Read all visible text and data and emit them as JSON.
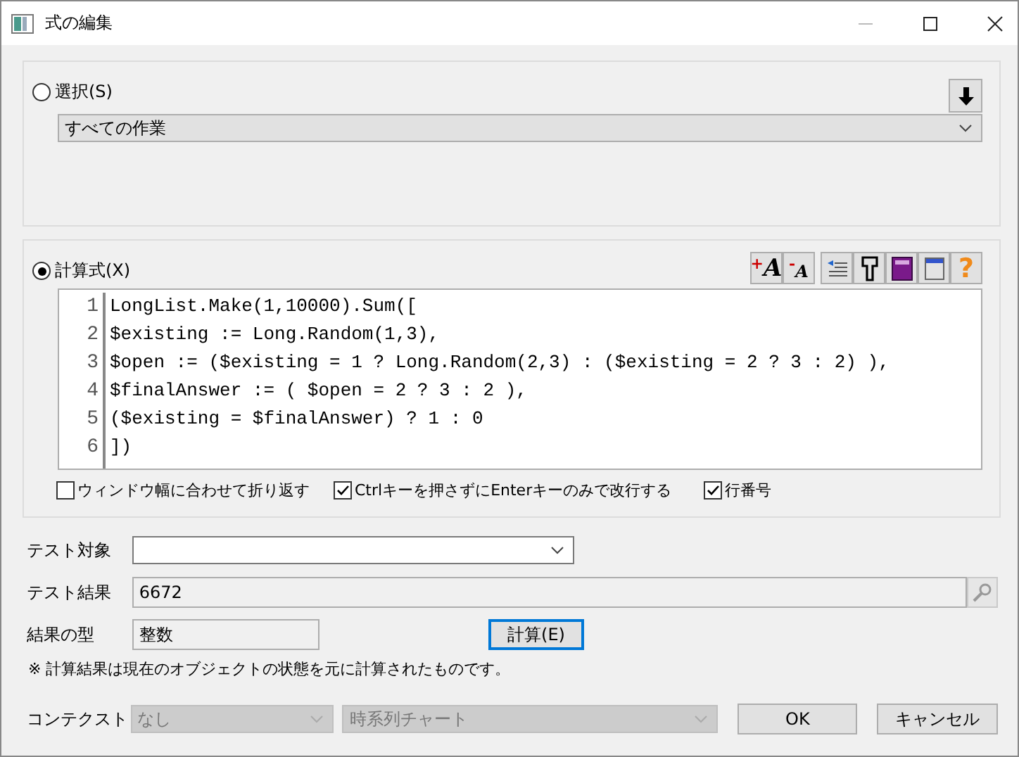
{
  "window": {
    "title": "式の編集"
  },
  "selection": {
    "label": "選択(S)",
    "selected": false,
    "dropdown_value": "すべての作業"
  },
  "formula": {
    "label": "計算式(X)",
    "selected": true,
    "toolbar": [
      {
        "kind": "font_up",
        "glyph": "A",
        "sign": "+"
      },
      {
        "kind": "font_down",
        "glyph": "A",
        "sign": "-"
      },
      {
        "kind": "indent"
      },
      {
        "kind": "format"
      },
      {
        "kind": "book"
      },
      {
        "kind": "window"
      },
      {
        "kind": "help",
        "glyph": "?"
      }
    ],
    "lines": [
      {
        "number": "1",
        "code": "LongList.Make(1,10000).Sum(["
      },
      {
        "number": "2",
        "code": "$existing := Long.Random(1,3),"
      },
      {
        "number": "3",
        "code": "$open := ($existing = 1 ? Long.Random(2,3) : ($existing = 2 ? 3 : 2) ),"
      },
      {
        "number": "4",
        "code": "$finalAnswer := ( $open = 2 ? 3 : 2 ),"
      },
      {
        "number": "5",
        "code": "($existing = $finalAnswer) ? 1 : 0"
      },
      {
        "number": "6",
        "code": "])"
      }
    ],
    "options": [
      {
        "label": "ウィンドウ幅に合わせて折り返す",
        "checked": false
      },
      {
        "label": "Ctrlキーを押さずにEnterキーのみで改行する",
        "checked": true
      },
      {
        "label": "行番号",
        "checked": true
      }
    ]
  },
  "test_target": {
    "label": "テスト対象"
  },
  "test_result": {
    "label": "テスト結果",
    "value": "6672"
  },
  "result_type": {
    "label": "結果の型",
    "value": "整数"
  },
  "calculate_button": "計算(E)",
  "note": "※ 計算結果は現在のオブジェクトの状態を元に計算されたものです。",
  "context": {
    "label": "コンテクスト",
    "value_1": "なし",
    "value_2": "時系列チャート",
    "disabled": true
  },
  "buttons": [
    "OK",
    "キャンセル"
  ]
}
